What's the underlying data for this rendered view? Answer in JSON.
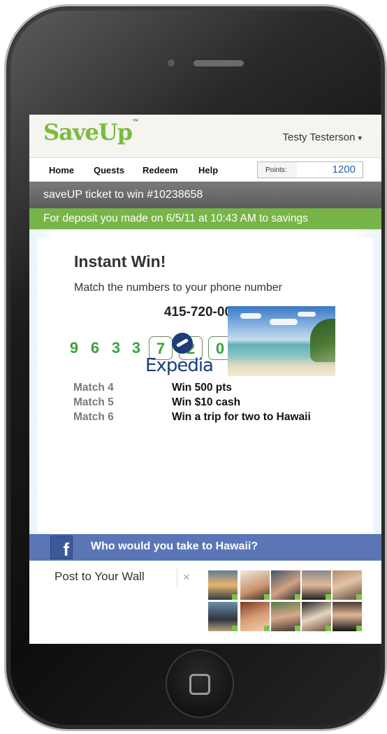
{
  "header": {
    "logo": "SaveUp",
    "logo_tm": "™",
    "user_name": "Testy Testerson",
    "user_caret": "▾"
  },
  "nav": {
    "items": [
      "Home",
      "Quests",
      "Redeem",
      "Help"
    ],
    "points_label": "Points:",
    "points_value": "1200"
  },
  "ticket_bar": "saveUP ticket to win #10238658",
  "deposit_bar": "For deposit you made on 6/5/11 at 10:43 AM to savings",
  "instant_win": {
    "title": "Instant Win!",
    "subtitle": "Match the numbers to your phone number",
    "phone_number": "415-720-0002",
    "plain_digits": [
      "9",
      "6",
      "3",
      "3"
    ],
    "matched_digits": [
      "7",
      "2",
      "0"
    ],
    "hidden_digits": [
      "?",
      "?",
      "?"
    ]
  },
  "prizes": [
    {
      "match": "Match 4",
      "prize": "Win 500 pts"
    },
    {
      "match": "Match 5",
      "prize": "Win $10 cash"
    },
    {
      "match": "Match 6",
      "prize": "Win a trip for two to Hawaii"
    }
  ],
  "sponsor": "Expedia",
  "facebook": {
    "icon_letter": "f",
    "question": "Who would you take to Hawaii?",
    "post_label": "Post to Your Wall",
    "close_glyph": "×"
  },
  "colors": {
    "brand_green": "#78b548",
    "digit_green": "#3aa33a",
    "facebook_blue": "#5b76b6",
    "points_blue": "#2a5fa6",
    "hidden_digit_blue": "#37a9e4"
  }
}
